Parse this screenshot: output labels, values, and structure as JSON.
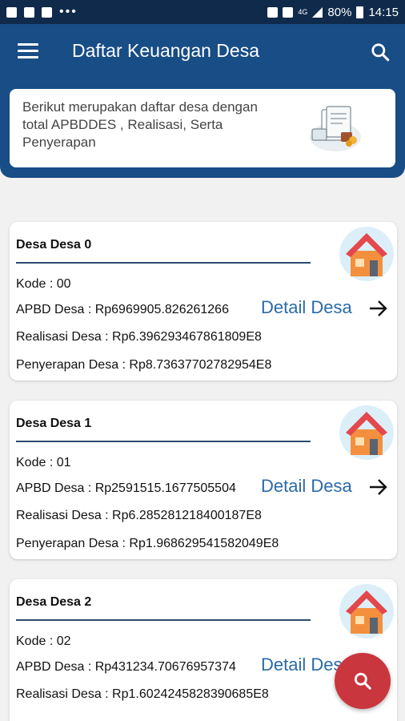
{
  "status_bar": {
    "battery": "80%",
    "time": "14:15",
    "network": "4G"
  },
  "app_bar": {
    "title": "Daftar Keuangan Desa"
  },
  "info": {
    "text": "Berikut merupakan daftar desa dengan total APBDDES , Realisasi, Serta Penyerapan"
  },
  "detail_label": "Detail Desa",
  "desa": [
    {
      "name": "Desa Desa 0",
      "kode": "Kode : 00",
      "apbd": "APBD Desa : Rp6969905.826261266",
      "realisasi": "Realisasi Desa : Rp6.396293467861809E8",
      "penyerapan": "Penyerapan Desa : Rp8.73637702782954E8"
    },
    {
      "name": "Desa Desa 1",
      "kode": "Kode : 01",
      "apbd": "APBD Desa : Rp2591515.1677505504",
      "realisasi": "Realisasi Desa : Rp6.285281218400187E8",
      "penyerapan": "Penyerapan Desa : Rp1.968629541582049E8"
    },
    {
      "name": "Desa Desa 2",
      "kode": "Kode : 02",
      "apbd": "APBD Desa : Rp431234.70676957374",
      "realisasi": "Realisasi Desa : Rp1.6024245828390685E8",
      "penyerapan": ""
    }
  ],
  "colors": {
    "primary": "#184d86",
    "status_bar": "#0f2a4a",
    "fab": "#c9363e",
    "link": "#2a6aa8"
  }
}
